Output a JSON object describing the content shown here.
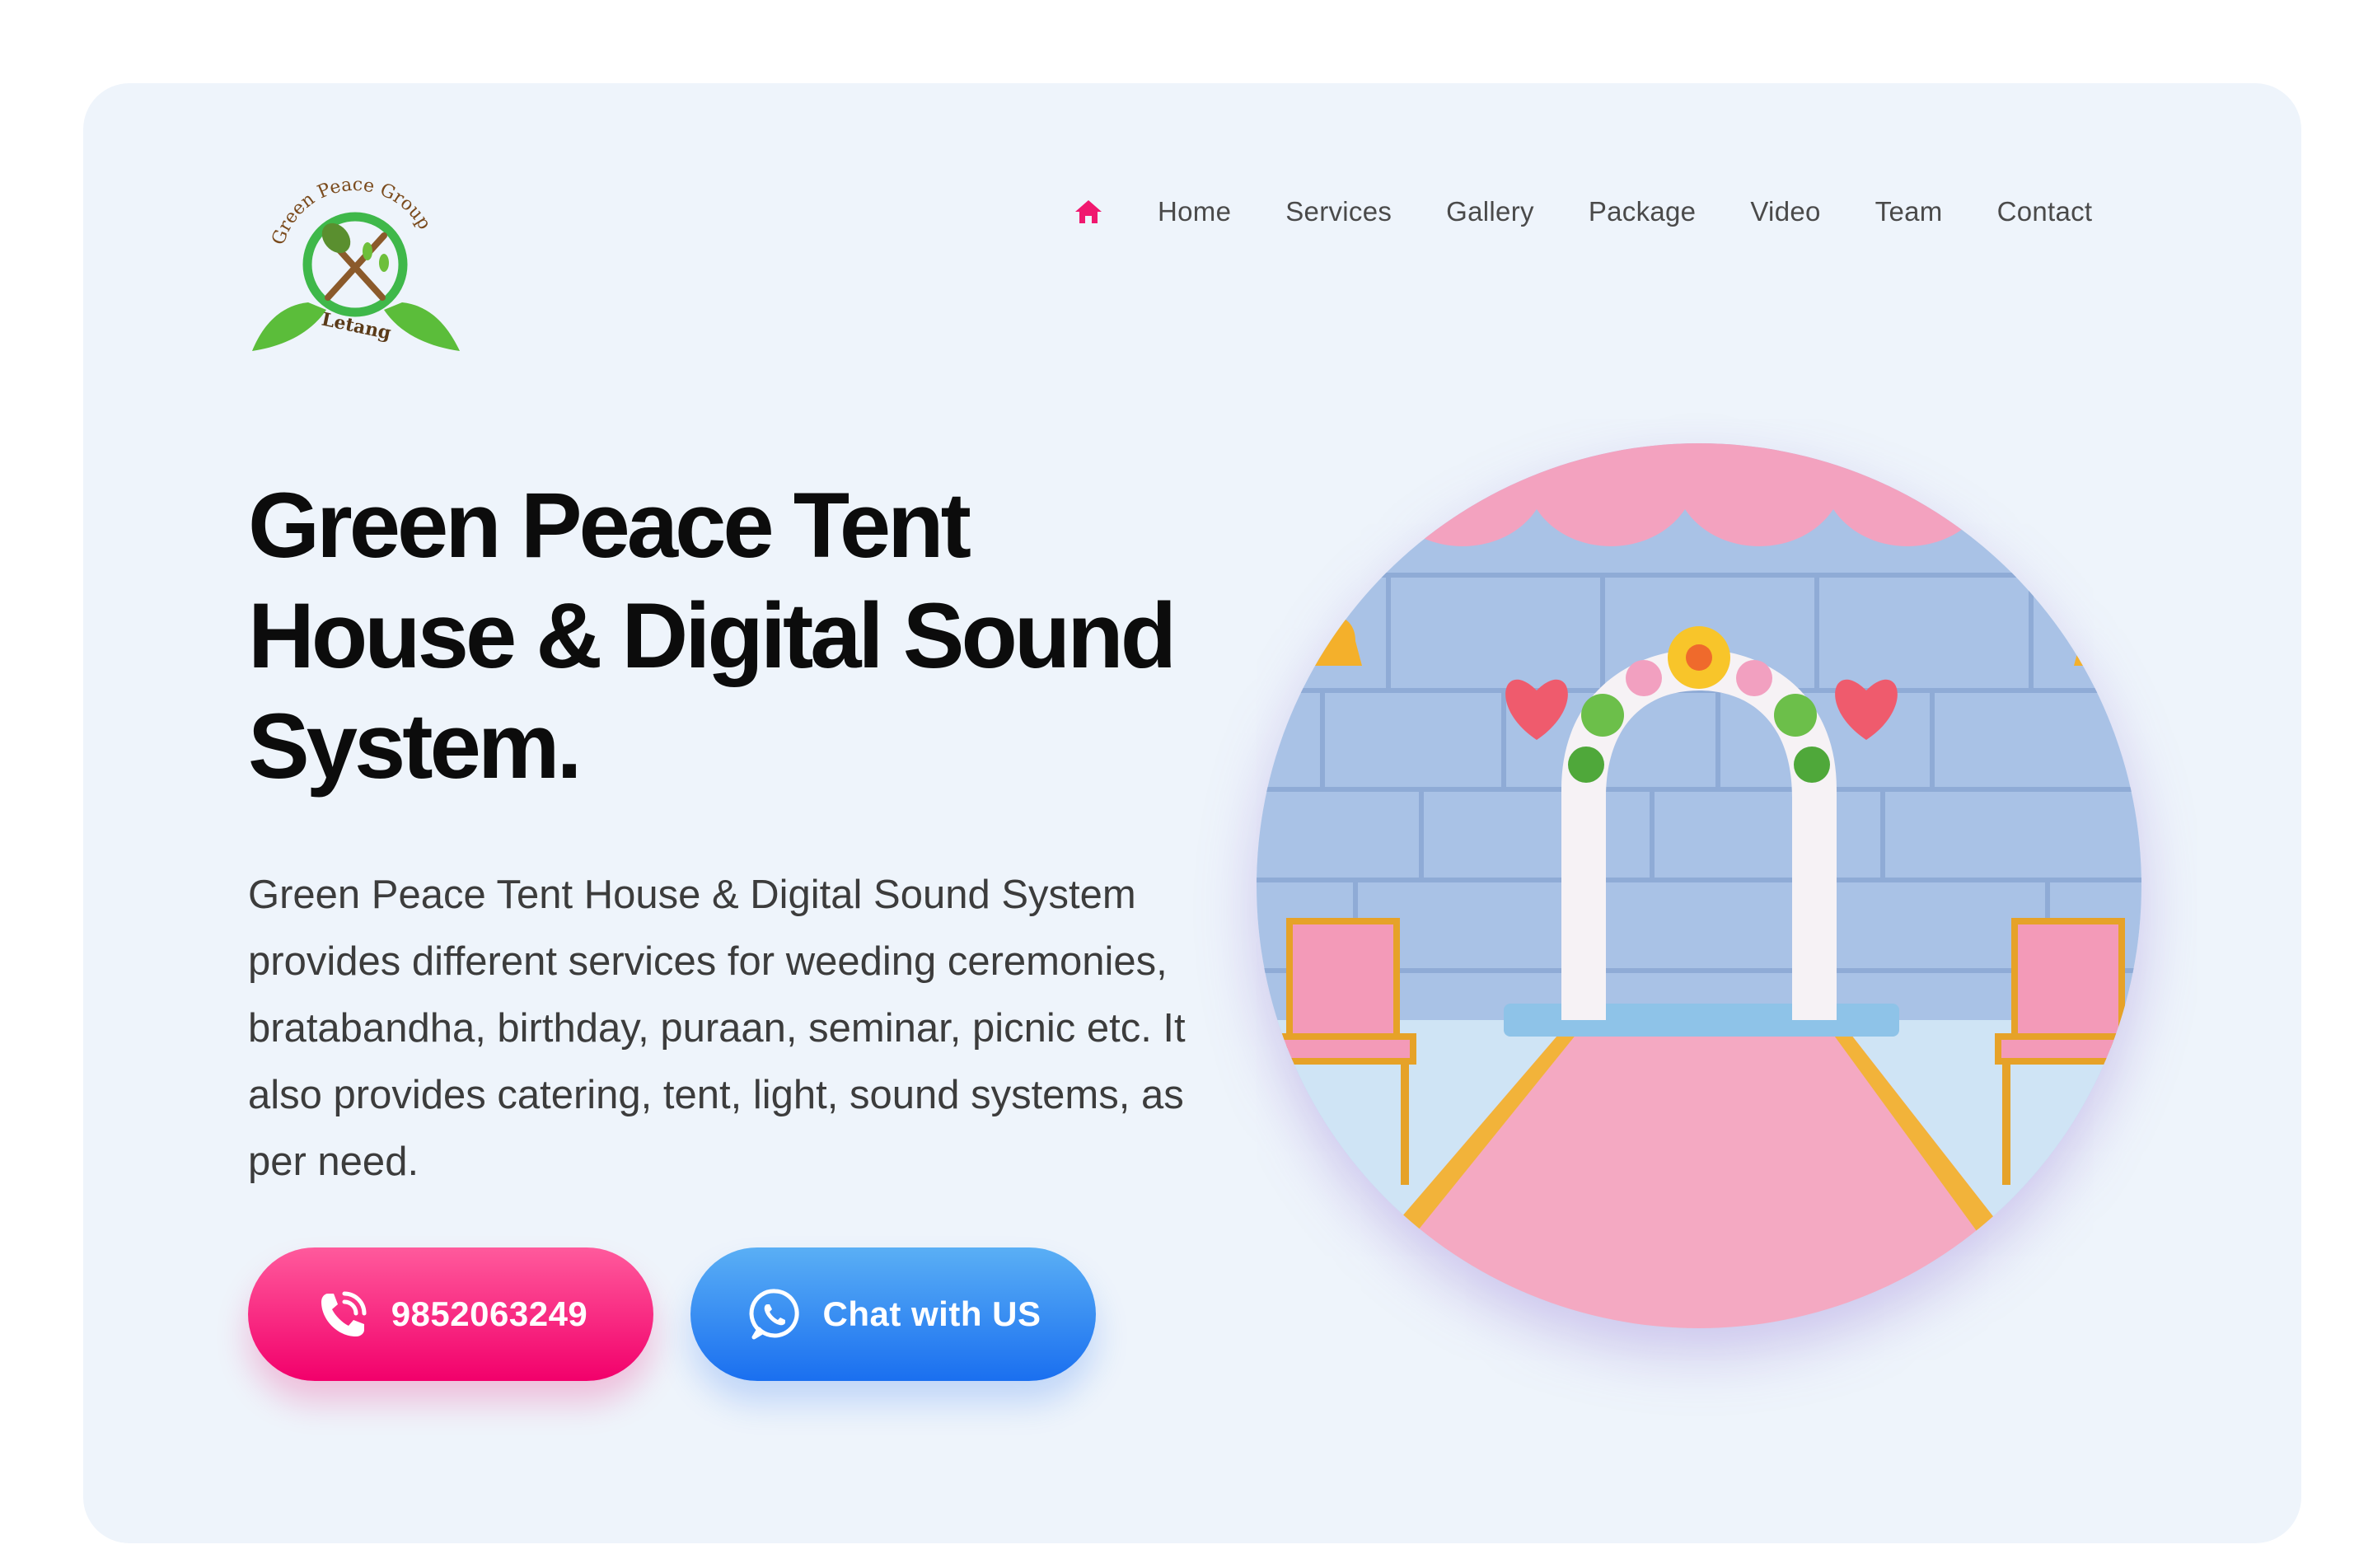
{
  "brand": {
    "logo_text_top": "Green Peace Group",
    "logo_text_bottom": "Letang"
  },
  "nav": {
    "items": [
      "Home",
      "Services",
      "Gallery",
      "Package",
      "Video",
      "Team",
      "Contact"
    ],
    "home_icon": "home-icon"
  },
  "hero": {
    "title": "Green Peace Tent House & Digital Sound System.",
    "description": "Green Peace Tent House & Digital Sound System provides different services for weeding ceremonies, bratabandha, birthday, puraan, seminar, picnic etc. It also provides catering, tent, light, sound systems, as per need."
  },
  "buttons": {
    "call_label": "9852063249",
    "call_icon": "phone-call-icon",
    "chat_label": "Chat with US",
    "chat_icon": "whatsapp-icon"
  },
  "colors": {
    "accent_pink": "#f2006b",
    "accent_blue": "#1a6ff0",
    "card_background": "#eef4fb"
  }
}
